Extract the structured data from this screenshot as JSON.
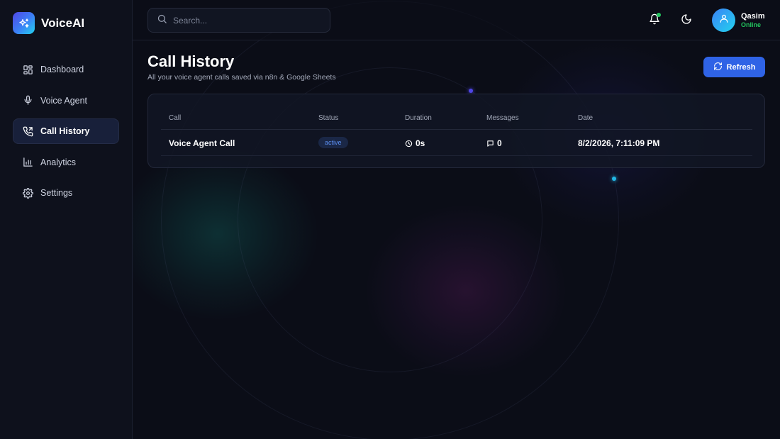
{
  "app": {
    "name": "VoiceAI"
  },
  "sidebar": {
    "items": [
      {
        "label": "Dashboard",
        "icon": "dashboard-icon",
        "active": false
      },
      {
        "label": "Voice Agent",
        "icon": "microphone-icon",
        "active": false
      },
      {
        "label": "Call History",
        "icon": "phone-icon",
        "active": true
      },
      {
        "label": "Analytics",
        "icon": "bar-chart-icon",
        "active": false
      },
      {
        "label": "Settings",
        "icon": "gear-icon",
        "active": false
      }
    ]
  },
  "header": {
    "search_placeholder": "Search...",
    "user": {
      "name": "Qasim",
      "status": "Online"
    }
  },
  "page": {
    "title": "Call History",
    "subtitle": "All your voice agent calls saved via n8n & Google Sheets",
    "refresh_label": "Refresh"
  },
  "table": {
    "columns": [
      "Call",
      "Status",
      "Duration",
      "Messages",
      "Date"
    ],
    "rows": [
      {
        "call": "Voice Agent Call",
        "status": "active",
        "duration": "0s",
        "messages": "0",
        "date": "8/2/2026, 7:11:09 PM"
      }
    ]
  },
  "colors": {
    "accent": "#2f63e6",
    "online": "#22c55e",
    "badge_text": "#5b8def"
  }
}
